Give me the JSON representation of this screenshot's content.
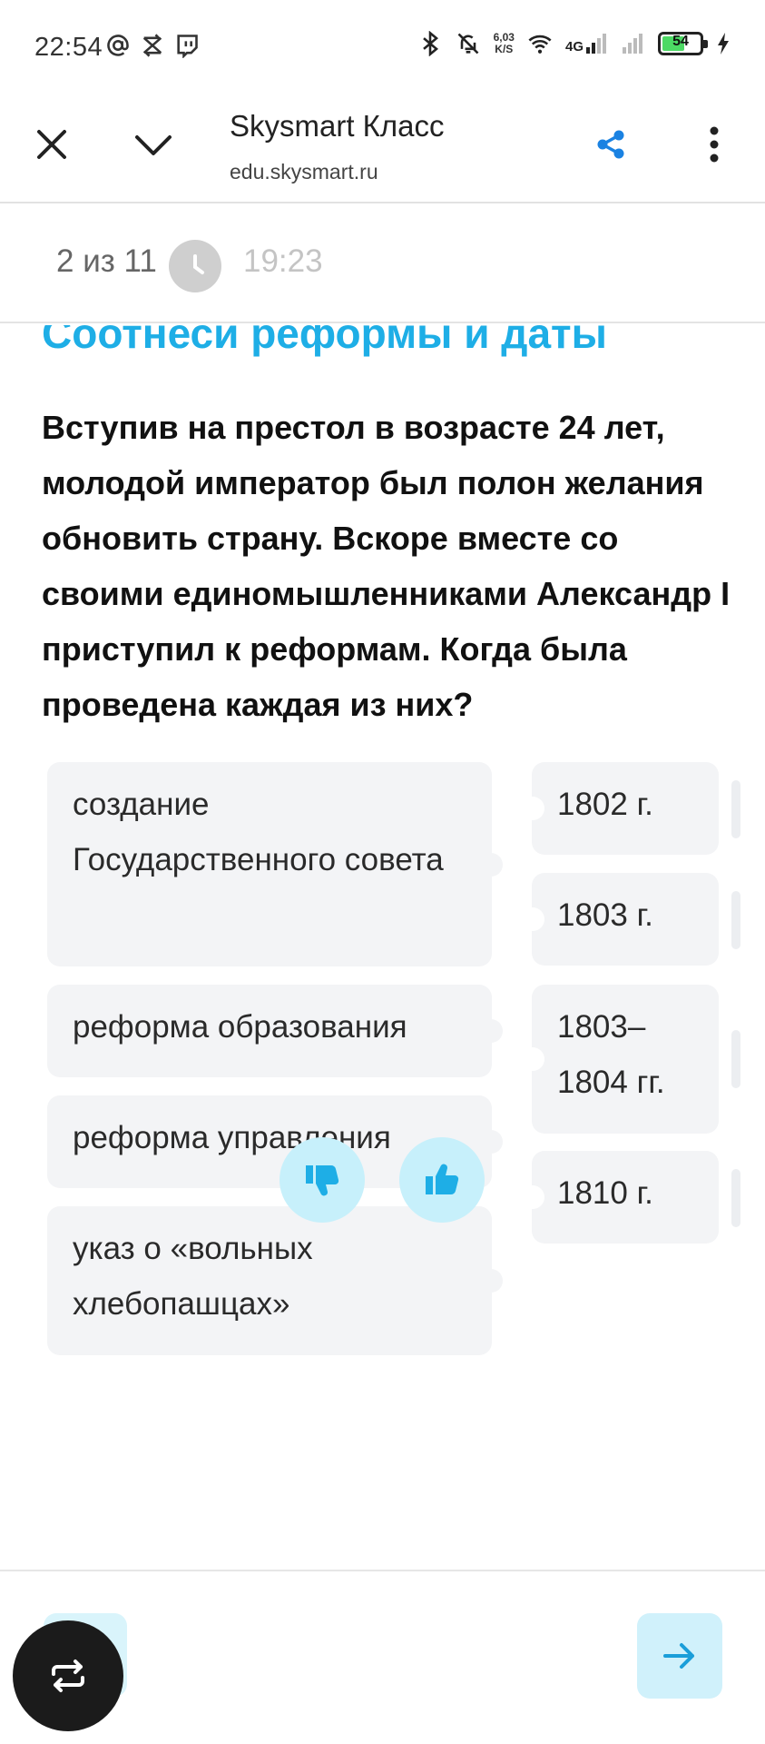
{
  "status_bar": {
    "time": "22:54",
    "net_speed_value": "6,03",
    "net_speed_unit": "K/S",
    "network": "4G",
    "battery": "54",
    "icons": [
      "at-icon",
      "sync-icon",
      "twitch-icon",
      "bluetooth-icon",
      "mute-icon",
      "wifi-icon",
      "signal-icon",
      "charging-icon"
    ]
  },
  "browser": {
    "title": "Skysmart Класс",
    "url": "edu.skysmart.ru",
    "accent": "#1a82e2"
  },
  "progress": {
    "count": "2 из 11",
    "timer": "19:23"
  },
  "task": {
    "title": "Соотнеси реформы и даты",
    "text": "Вступив на престол в возрасте 24 лет, молодой император был полон желания обновить страну. Вскоре вместе со своими единомышленниками Александр I приступил к реформам. Когда была проведена каждая из них?",
    "title_color": "#1eaee6"
  },
  "match": {
    "left": [
      "создание Государственного совета",
      "реформа образования",
      "реформа управления",
      "указ о «вольных хлебопашцах»"
    ],
    "right": [
      "1802 г.",
      "1803 г.",
      "1803–1804 гг.",
      "1810 г."
    ]
  },
  "feedback": {
    "dislike_icon": "thumbs-down-icon",
    "like_icon": "thumbs-up-icon",
    "color": "#1eaee6"
  },
  "bottom_nav": {
    "prev_icon": "arrow-left-icon",
    "next_icon": "arrow-right-icon",
    "float_icon": "repeat-icon"
  }
}
